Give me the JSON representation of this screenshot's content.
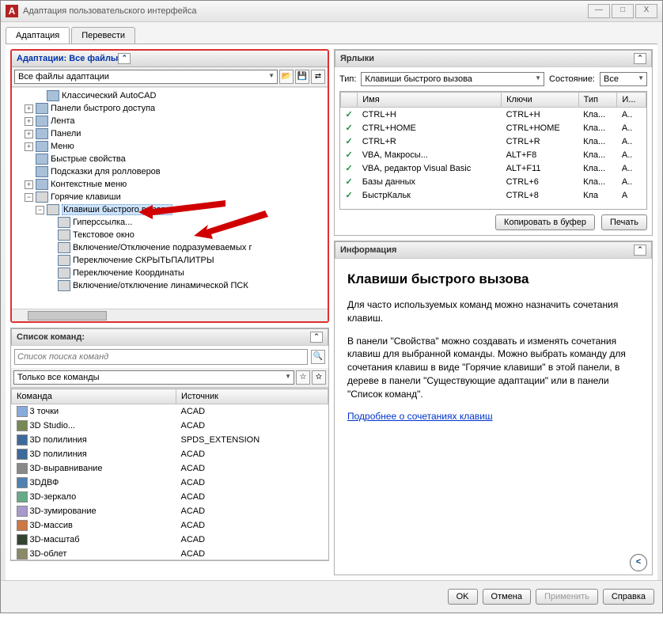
{
  "window": {
    "title": "Адаптация пользовательского интерфейса"
  },
  "tabs": [
    "Адаптация",
    "Перевести"
  ],
  "adaptPanel": {
    "title": "Адаптации: Все файлы",
    "combo": "Все файлы адаптации",
    "tree": [
      {
        "lvl": 2,
        "exp": "",
        "icon": "gear",
        "label": "Классический AutoCAD"
      },
      {
        "lvl": 1,
        "exp": "+",
        "icon": "bar",
        "label": "Панели быстрого доступа"
      },
      {
        "lvl": 1,
        "exp": "+",
        "icon": "bar",
        "label": "Лента"
      },
      {
        "lvl": 1,
        "exp": "+",
        "icon": "bar",
        "label": "Панели"
      },
      {
        "lvl": 1,
        "exp": "+",
        "icon": "bar",
        "label": "Меню"
      },
      {
        "lvl": 1,
        "exp": "",
        "icon": "bar",
        "label": "Быстрые свойства"
      },
      {
        "lvl": 1,
        "exp": "",
        "icon": "bar",
        "label": "Подсказки для ролловеров"
      },
      {
        "lvl": 1,
        "exp": "+",
        "icon": "bar",
        "label": "Контекстные меню"
      },
      {
        "lvl": 1,
        "exp": "−",
        "icon": "kb",
        "label": "Горячие клавиши"
      },
      {
        "lvl": 2,
        "exp": "−",
        "icon": "kb",
        "label": "Клавиши быстрого вызова",
        "sel": true
      },
      {
        "lvl": 3,
        "exp": "",
        "icon": "kb",
        "label": "Гиперссылка..."
      },
      {
        "lvl": 3,
        "exp": "",
        "icon": "kb",
        "label": "Текстовое окно"
      },
      {
        "lvl": 3,
        "exp": "",
        "icon": "kb",
        "label": "Включение/Отключение подразумеваемых г"
      },
      {
        "lvl": 3,
        "exp": "",
        "icon": "kb",
        "label": "Переключение СКРЫТЬПАЛИТРЫ"
      },
      {
        "lvl": 3,
        "exp": "",
        "icon": "kb",
        "label": "Переключение Координаты"
      },
      {
        "lvl": 3,
        "exp": "",
        "icon": "kb",
        "label": "Включение/отключение линамической ПСК"
      }
    ]
  },
  "cmdList": {
    "title": "Список команд:",
    "placeholder": "Список поиска команд",
    "filter": "Только все команды",
    "headers": [
      "Команда",
      "Источник"
    ],
    "rows": [
      {
        "c": "#88aadd",
        "name": "3 точки",
        "src": "ACAD"
      },
      {
        "c": "#778855",
        "name": "3D Studio...",
        "src": "ACAD"
      },
      {
        "c": "#3d6a9a",
        "name": "3D полилиния",
        "src": "SPDS_EXTENSION"
      },
      {
        "c": "#3d6a9a",
        "name": "3D полилиния",
        "src": "ACAD"
      },
      {
        "c": "#888888",
        "name": "3D-выравнивание",
        "src": "ACAD"
      },
      {
        "c": "#5080b0",
        "name": "3DДВФ",
        "src": "ACAD"
      },
      {
        "c": "#66aa88",
        "name": "3D-зеркало",
        "src": "ACAD"
      },
      {
        "c": "#a899cc",
        "name": "3D-зумирование",
        "src": "ACAD"
      },
      {
        "c": "#cc7744",
        "name": "3D-массив",
        "src": "ACAD"
      },
      {
        "c": "#334433",
        "name": "3D-масштаб",
        "src": "ACAD"
      },
      {
        "c": "#8a8a66",
        "name": "3D-облет",
        "src": "ACAD"
      }
    ]
  },
  "shortcuts": {
    "title": "Ярлыки",
    "typeLabel": "Тип:",
    "typeValue": "Клавиши быстрого вызова",
    "stateLabel": "Состояние:",
    "stateValue": "Все",
    "headers": [
      "Имя",
      "Ключи",
      "Тип",
      "И..."
    ],
    "rows": [
      {
        "name": "CTRL+H",
        "keys": "CTRL+H",
        "type": "Кла...",
        "src": "A.."
      },
      {
        "name": "CTRL+HOME",
        "keys": "CTRL+HOME",
        "type": "Кла...",
        "src": "A.."
      },
      {
        "name": "CTRL+R",
        "keys": "CTRL+R",
        "type": "Кла...",
        "src": "A.."
      },
      {
        "name": "VBA, Макросы...",
        "keys": "ALT+F8",
        "type": "Кла...",
        "src": "A.."
      },
      {
        "name": "VBA, редактор Visual Basic",
        "keys": "ALT+F11",
        "type": "Кла...",
        "src": "A.."
      },
      {
        "name": "Базы данных",
        "keys": "CTRL+6",
        "type": "Кла...",
        "src": "A.."
      },
      {
        "name": "БыстрКальк",
        "keys": "CTRL+8",
        "type": "Кла",
        "src": "A"
      }
    ],
    "copyBtn": "Копировать в буфер",
    "printBtn": "Печать"
  },
  "info": {
    "title": "Информация",
    "heading": "Клавиши быстрого вызова",
    "p1": "Для часто используемых команд можно назначить сочетания клавиш.",
    "p2": "В панели \"Свойства\" можно создавать и изменять сочетания клавиш для выбранной команды. Можно выбрать команду для сочетания клавиш в виде \"Горячие клавиши\" в этой панели, в дереве в панели \"Существующие адаптации\" или в панели \"Список команд\".",
    "link": "Подробнее о сочетаниях клавиш"
  },
  "buttons": {
    "ok": "OK",
    "cancel": "Отмена",
    "apply": "Применить",
    "help": "Справка"
  }
}
